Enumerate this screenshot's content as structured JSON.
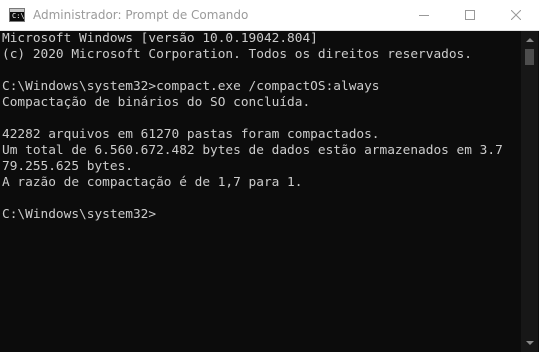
{
  "window": {
    "title": "Administrador: Prompt de Comando",
    "app_icon": "cmd-console-icon",
    "icon_prompt_text": "C:\\",
    "controls": {
      "minimize_icon": "minimize-icon",
      "maximize_icon": "maximize-icon",
      "close_icon": "close-icon"
    }
  },
  "console": {
    "lines": [
      "Microsoft Windows [versão 10.0.19042.804]",
      "(c) 2020 Microsoft Corporation. Todos os direitos reservados.",
      "",
      "C:\\Windows\\system32>compact.exe /compactOS:always",
      "Compactação de binários do SO concluída.",
      "",
      "42282 arquivos em 61270 pastas foram compactados.",
      "Um total de 6.560.672.482 bytes de dados estão armazenados em 3.7",
      "79.255.625 bytes.",
      "A razão de compactação é de 1,7 para 1.",
      "",
      "C:\\Windows\\system32>"
    ]
  },
  "colors": {
    "console_background": "#0c0c0c",
    "console_text": "#cccccc",
    "titlebar_background": "#ffffff",
    "title_text": "#9a9a9a"
  },
  "scrollbar": {
    "up_icon": "scroll-up-arrow-icon",
    "down_icon": "scroll-down-arrow-icon"
  }
}
